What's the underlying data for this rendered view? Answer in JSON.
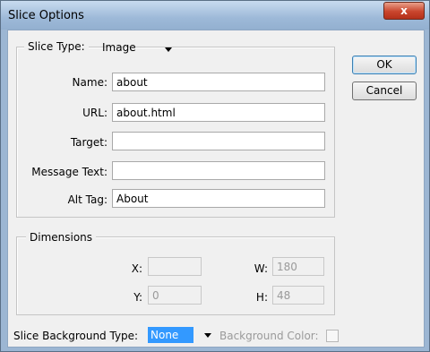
{
  "window": {
    "title": "Slice Options",
    "close_symbol": "x"
  },
  "slice_type": {
    "label": "Slice Type:",
    "value": "Image"
  },
  "fields": {
    "name": {
      "label": "Name:",
      "value": "about"
    },
    "url": {
      "label": "URL:",
      "value": "about.html"
    },
    "target": {
      "label": "Target:",
      "value": ""
    },
    "message": {
      "label": "Message Text:",
      "value": ""
    },
    "alt": {
      "label": "Alt Tag:",
      "value": "About"
    }
  },
  "buttons": {
    "ok": "OK",
    "cancel": "Cancel"
  },
  "dimensions": {
    "title": "Dimensions",
    "x_label": "X:",
    "x_value": "",
    "y_label": "Y:",
    "y_value": "0",
    "w_label": "W:",
    "w_value": "180",
    "h_label": "H:",
    "h_value": "48"
  },
  "background": {
    "label": "Slice Background Type:",
    "value": "None",
    "color_label": "Background Color:"
  },
  "colors": {
    "selection": "#3399ff",
    "title_bar": "#9cb6d3",
    "close": "#c9452d"
  }
}
